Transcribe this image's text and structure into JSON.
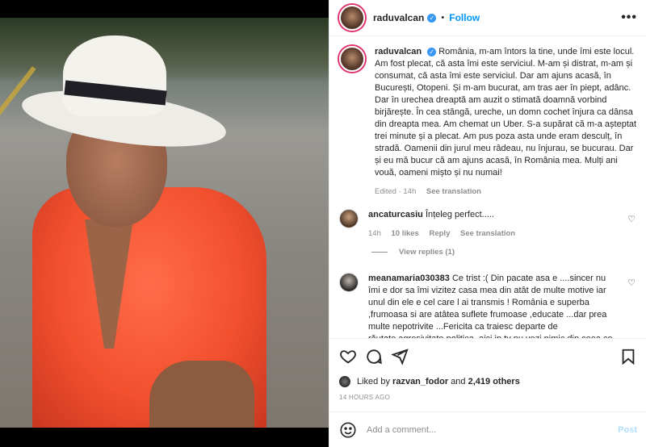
{
  "header": {
    "username": "raduvalcan",
    "follow_label": "Follow",
    "more_label": "•••"
  },
  "caption": {
    "username": "raduvalcan",
    "text": "România, m-am întors la tine, unde îmi este locul. Am fost plecat, că asta îmi este serviciul. M-am și distrat, m-am și consumat, că asta îmi este serviciul. Dar am ajuns acasă, în București, Otopeni. Și m-am bucurat, am tras aer în piept, adânc. Dar în urechea dreaptă am auzit o stimată doamnă vorbind birjărește. În cea stângă, ureche, un domn cochet înjura ca dânsa din dreapta mea. Am chemat un Uber. S-a supărat că m-a așteptat trei minute și a plecat. Am pus poza asta unde eram desculț, în stradă. Oamenii din jurul meu râdeau, nu înjurau, se bucurau. Dar și eu mă bucur că am ajuns acasă, în România mea. Mulți ani vouă, oameni mișto și nu numai!",
    "edited": "Edited · 14h",
    "see_translation": "See translation"
  },
  "comments": [
    {
      "username": "ancaturcasiu",
      "text": "Înțeleg perfect.....",
      "time": "14h",
      "likes": "10 likes",
      "reply": "Reply",
      "see_translation": "See translation",
      "view_replies": "View replies (1)"
    },
    {
      "username": "meanamaria030383",
      "text": "Ce trist :( Din pacate asa e ....sincer nu îmi e dor sa îmi vizitez casa mea din atât de multe motive iar unul din ele e cel care l ai transmis ! România e superba ,frumoasa si are atâtea suflete frumoase ,educate ...dar prea multe nepotrivite ...Fericita ca traiesc departe de răutate,agresivitate,politica ,aici in tv nu vezi nimic din ceea ce"
    }
  ],
  "actions": {
    "liked_prefix": "Liked by",
    "liked_user": "razvan_fodor",
    "liked_and": "and",
    "liked_others": "2,419 others",
    "timestamp": "14 HOURS AGO"
  },
  "add_comment": {
    "placeholder": "Add a comment...",
    "post_label": "Post"
  },
  "colors": {
    "accent": "#0095f6",
    "verified": "#3897f0",
    "muted": "#8e8e8e"
  }
}
